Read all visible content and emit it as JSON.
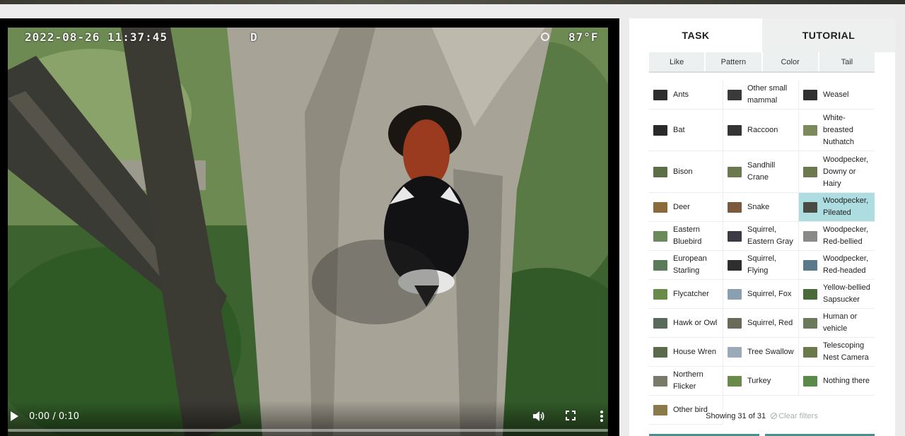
{
  "video": {
    "osd_timestamp": "2022-08-26 11:37:45",
    "osd_mode": "D",
    "osd_temperature": "87°F",
    "time_display": "0:00 / 0:10",
    "progress_fraction": 0.0
  },
  "panel": {
    "tabs": [
      {
        "label": "TASK",
        "active": true
      },
      {
        "label": "TUTORIAL",
        "active": false
      }
    ],
    "filters": [
      "Like",
      "Pattern",
      "Color",
      "Tail"
    ],
    "choices": [
      {
        "label": "Ants",
        "thumb": "#2e2e2e"
      },
      {
        "label": "Other small mammal",
        "thumb": "#3a3a3a"
      },
      {
        "label": "Weasel",
        "thumb": "#303030"
      },
      {
        "label": "Bat",
        "thumb": "#2a2a2a"
      },
      {
        "label": "Raccoon",
        "thumb": "#353535"
      },
      {
        "label": "White-breasted Nuthatch",
        "thumb": "#7a8a5a"
      },
      {
        "label": "Bison",
        "thumb": "#5c6e46"
      },
      {
        "label": "Sandhill Crane",
        "thumb": "#6a7a4e"
      },
      {
        "label": "Woodpecker, Downy or Hairy",
        "thumb": "#6b7850"
      },
      {
        "label": "Deer",
        "thumb": "#8a6a3a"
      },
      {
        "label": "Snake",
        "thumb": "#7a5a3a"
      },
      {
        "label": "Woodpecker, Pileated",
        "thumb": "#4a4a44"
      },
      {
        "label": "Eastern Bluebird",
        "thumb": "#6a8a5a"
      },
      {
        "label": "Squirrel, Eastern Gray",
        "thumb": "#3b3b44"
      },
      {
        "label": "Woodpecker, Red-bellied",
        "thumb": "#8a8a88"
      },
      {
        "label": "European Starling",
        "thumb": "#5a7a5a"
      },
      {
        "label": "Squirrel, Flying",
        "thumb": "#2e2e2e"
      },
      {
        "label": "Woodpecker, Red-headed",
        "thumb": "#5a7a8a"
      },
      {
        "label": "Flycatcher",
        "thumb": "#6a8a4a"
      },
      {
        "label": "Squirrel, Fox",
        "thumb": "#8aa0b0"
      },
      {
        "label": "Yellow-bellied Sapsucker",
        "thumb": "#4a6a3a"
      },
      {
        "label": "Hawk or Owl",
        "thumb": "#5a6a5a"
      },
      {
        "label": "Squirrel, Red",
        "thumb": "#6a6a5a"
      },
      {
        "label": "Human or vehicle",
        "thumb": "#6a7a5a"
      },
      {
        "label": "House Wren",
        "thumb": "#5a6a4a"
      },
      {
        "label": "Tree Swallow",
        "thumb": "#9aaab8"
      },
      {
        "label": "Telescoping Nest Camera",
        "thumb": "#6a7a4a"
      },
      {
        "label": "Northern Flicker",
        "thumb": "#7a7a6a"
      },
      {
        "label": "Turkey",
        "thumb": "#6a8a4a"
      },
      {
        "label": "Nothing there",
        "thumb": "#5a8a4a"
      },
      {
        "label": "Other bird",
        "thumb": "#8a7a4a"
      }
    ],
    "selected_choice": "Woodpecker, Pileated",
    "showing_text": "Showing 31 of 31",
    "clear_filters_label": "Clear filters"
  }
}
